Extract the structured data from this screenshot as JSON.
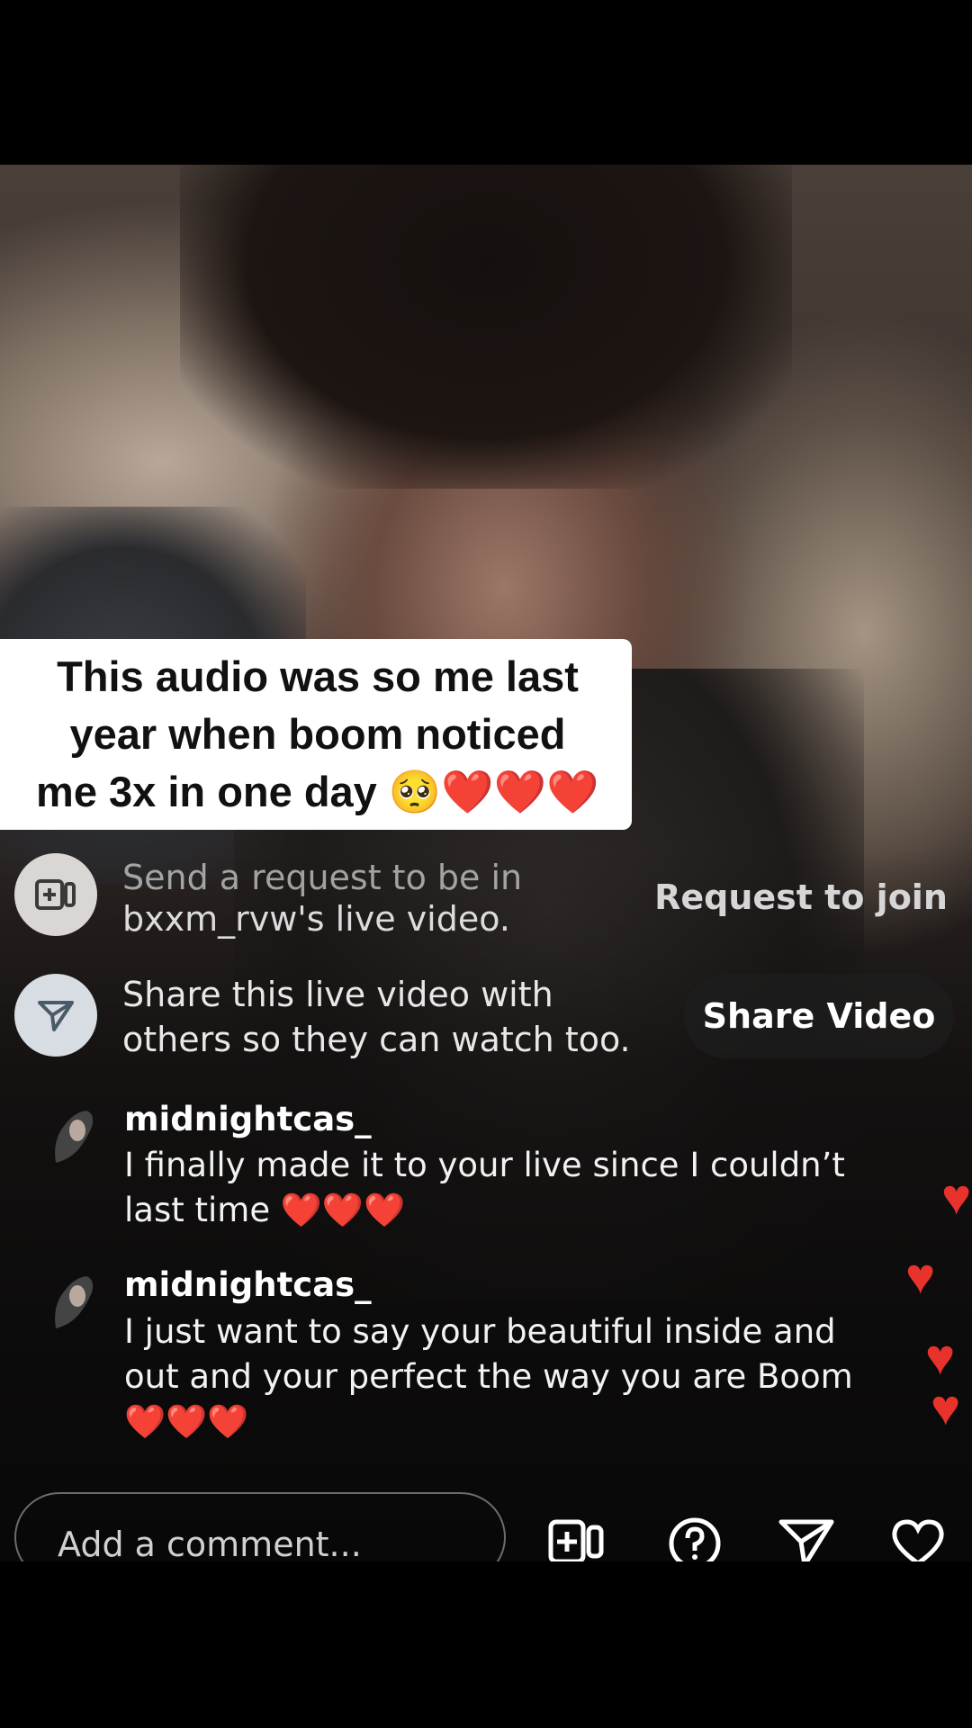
{
  "caption": {
    "lines": [
      "This audio was so me last",
      "year when boom noticed",
      "me 3x in one day 🥺❤️❤️❤️"
    ]
  },
  "live": {
    "request_row": {
      "text_line1": "Send a request to be in",
      "text_line2": "bxxm_rvw's live video.",
      "button": "Request to join",
      "icon": "add-guest-icon"
    },
    "share_row": {
      "text_line1": "Share this live video with",
      "text_line2": "others so they can watch too.",
      "button": "Share Video",
      "icon": "send-icon"
    },
    "comments": [
      {
        "username": "midnightcas_",
        "text_line1": "I finally made it to your live since I couldn’t",
        "text_line2": "last time ❤️❤️❤️"
      },
      {
        "username": "midnightcas_",
        "text_line1": "I just want to say your beautiful inside and",
        "text_line2": "out and your perfect the way you are Boom",
        "text_line3": "❤️❤️❤️"
      }
    ]
  },
  "bottom_bar": {
    "placeholder": "Add a comment...",
    "icons": [
      "add-guest-icon",
      "question-icon",
      "send-icon",
      "heart-icon"
    ]
  },
  "colors": {
    "heart": "#e8322c",
    "caption_bg": "#ffffff",
    "share_icon_bg": "#d7dde2"
  }
}
